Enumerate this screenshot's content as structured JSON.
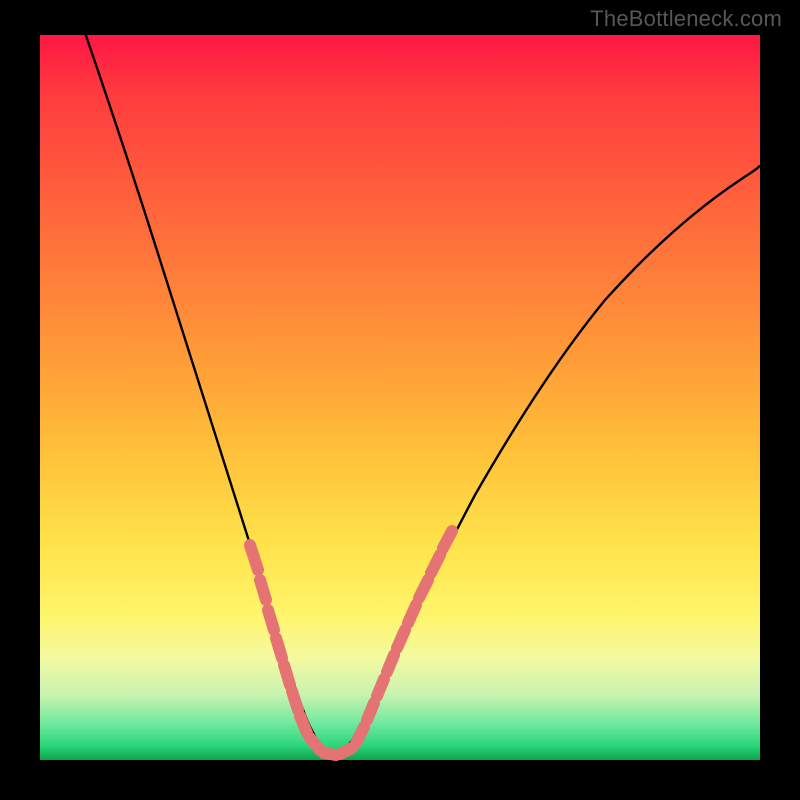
{
  "attribution": "TheBottleneck.com",
  "colors": {
    "black_frame": "#000000",
    "curve": "#000000",
    "overlay_pink": "#e57373",
    "gradient_top": "#ff1744",
    "gradient_bottom": "#0fa44d"
  },
  "chart_data": {
    "type": "line",
    "title": "",
    "xlabel": "",
    "ylabel": "",
    "xlim": [
      0,
      100
    ],
    "ylim": [
      0,
      100
    ],
    "grid": false,
    "legend": false,
    "annotations": [
      "Pink dashed overlay segments highlight portions of the curve near the minimum on both sides."
    ],
    "series": [
      {
        "name": "bottleneck-curve",
        "x": [
          0,
          6,
          10,
          14,
          18,
          22,
          25,
          28,
          30,
          32,
          33.5,
          35,
          36.5,
          38,
          40,
          43,
          47,
          52,
          58,
          65,
          72,
          80,
          88,
          96,
          100
        ],
        "y": [
          108,
          94,
          84,
          74,
          63,
          52,
          42,
          32,
          24,
          16,
          10,
          5,
          2,
          1,
          2,
          6,
          13,
          21,
          30,
          39,
          47,
          55,
          62,
          68,
          71
        ]
      }
    ],
    "highlight_segments": [
      {
        "side": "left",
        "x_range": [
          27,
          35
        ],
        "y_range": [
          35,
          5
        ]
      },
      {
        "side": "right",
        "x_range": [
          40,
          50
        ],
        "y_range": [
          2,
          18
        ]
      }
    ]
  }
}
